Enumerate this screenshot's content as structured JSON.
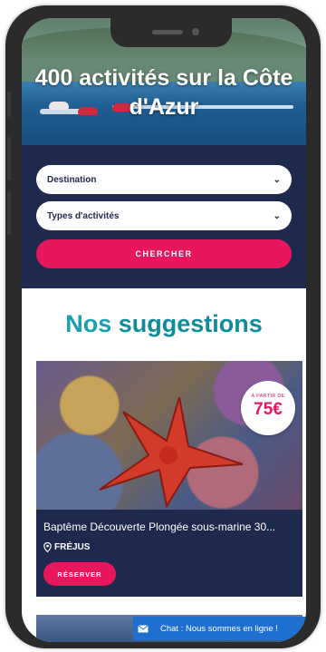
{
  "hero": {
    "title": "400 activités sur la Côte d'Azur"
  },
  "search": {
    "destination_placeholder": "Destination",
    "activity_types_placeholder": "Types d'activités",
    "submit_label": "CHERCHER"
  },
  "suggestions": {
    "title_light": "Nos ",
    "title_bold": "suggestions",
    "cards": [
      {
        "price_prefix": "À PARTIR DE",
        "price": "75€",
        "title": "Baptême Découverte Plongée sous-marine 30...",
        "location": "FRÉJUS",
        "book_label": "RÉSERVER"
      }
    ]
  },
  "chat": {
    "label": "Chat : Nous sommes en ligne !",
    "icon": "envelope-icon"
  },
  "colors": {
    "navy": "#1d2a4d",
    "accent_pink": "#e8175d",
    "teal": "#1a9fb4",
    "chat_blue": "#1e6fd0"
  }
}
